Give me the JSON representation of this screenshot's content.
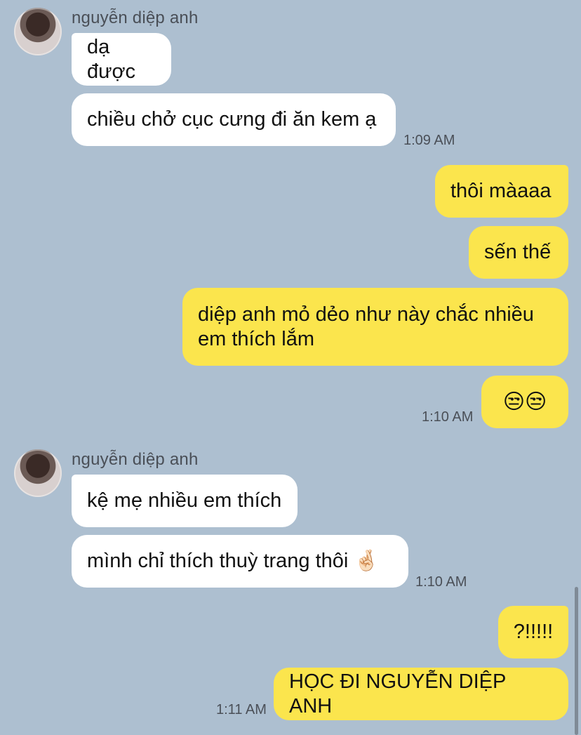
{
  "chat": {
    "contact_name": "nguyễn diệp anh",
    "groups": [
      {
        "sender": "nguyễn diệp anh",
        "messages": [
          "dạ được",
          "chiều chở cục cưng đi ăn kem ạ"
        ],
        "time": "1:09 AM"
      },
      {
        "sender": "me",
        "messages": [
          "thôi màaaa",
          "sến thế",
          "diệp anh mỏ dẻo như này chắc nhiều em thích lắm",
          "😒😒"
        ],
        "time": "1:10 AM"
      },
      {
        "sender": "nguyễn diệp anh",
        "messages": [
          "kệ mẹ nhiều em thích",
          "mình chỉ thích thuỳ trang thôi 🤞🏻"
        ],
        "time": "1:10 AM"
      },
      {
        "sender": "me",
        "messages": [
          "?!!!!!",
          "HỌC ĐI NGUYỄN DIỆP ANH"
        ],
        "time": "1:11 AM"
      }
    ]
  },
  "colors": {
    "background": "#adbfd0",
    "incoming_bubble": "#ffffff",
    "outgoing_bubble": "#fbe54d"
  }
}
